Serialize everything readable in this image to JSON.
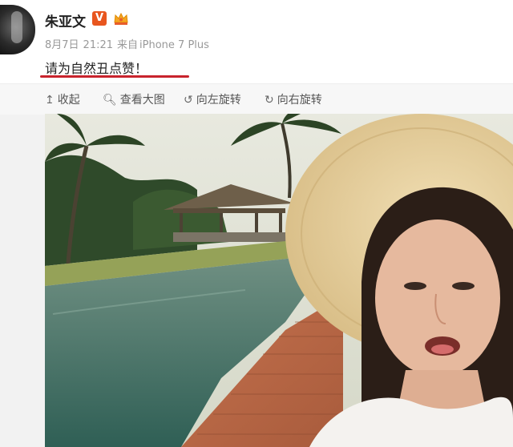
{
  "post": {
    "user_name": "朱亚文",
    "verified_badge": "V",
    "date": "8月7日",
    "time": "21:21",
    "source_prefix": "来自",
    "source_device": "iPhone 7 Plus",
    "text": "请为自然丑点赞！"
  },
  "toolbar": {
    "collapse": "收起",
    "view_large": "查看大图",
    "rotate_left": "向左旋转",
    "rotate_right": "向右旋转"
  },
  "icons": {
    "collapse": "collapse-up-icon",
    "view_large": "magnifier-icon",
    "rotate_left": "rotate-left-icon",
    "rotate_right": "rotate-right-icon",
    "crown": "crown-icon"
  },
  "colors": {
    "badge": "#e8561f",
    "underline": "#c8232c",
    "name": "#222222",
    "meta": "#999999"
  }
}
